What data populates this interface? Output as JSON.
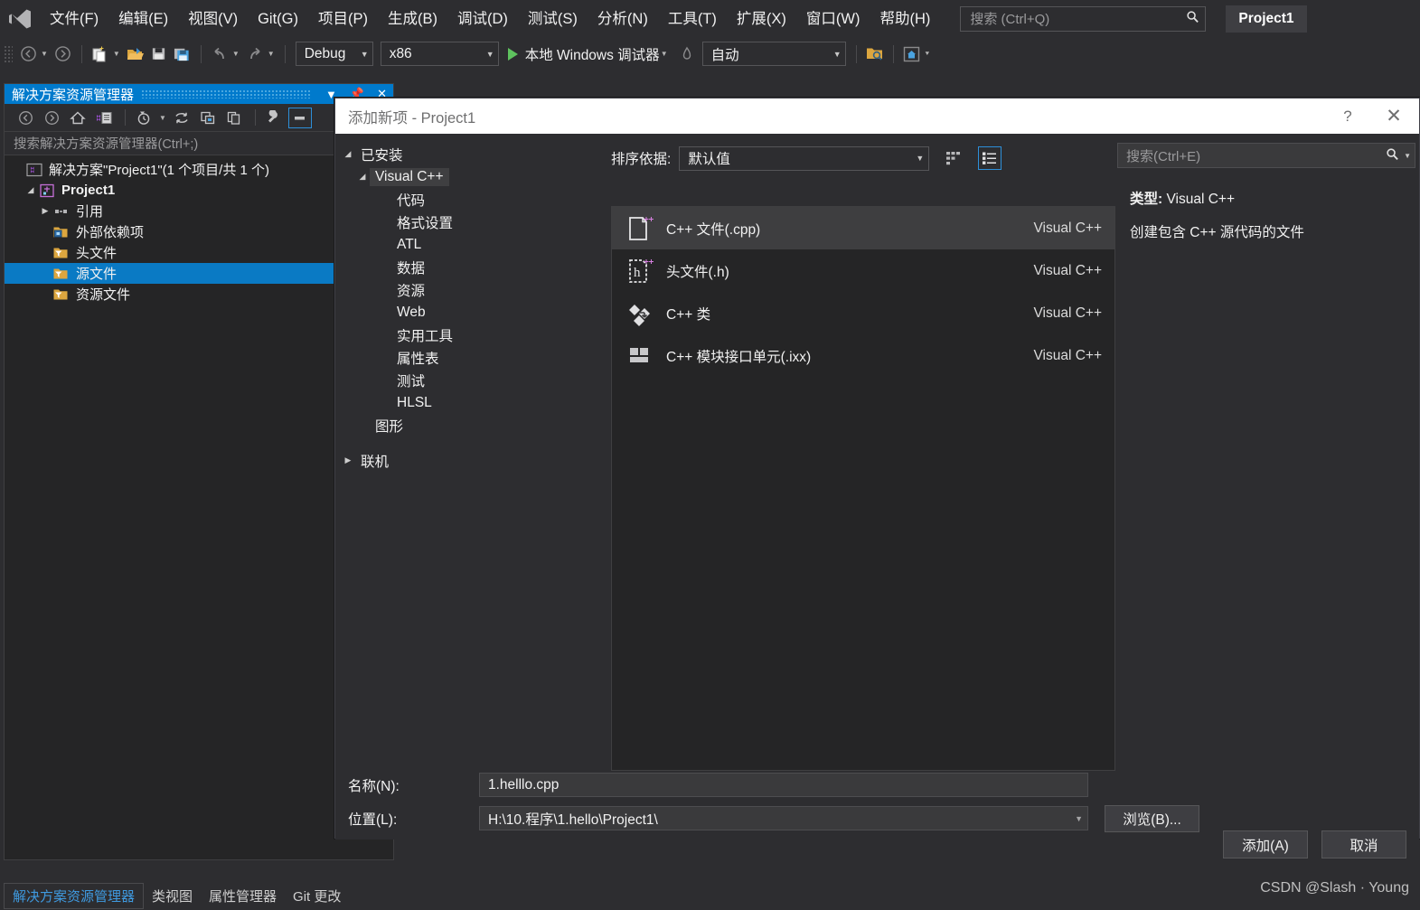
{
  "menubar": {
    "logo_icon": "visual-studio-logo",
    "items": [
      "文件(F)",
      "编辑(E)",
      "视图(V)",
      "Git(G)",
      "项目(P)",
      "生成(B)",
      "调试(D)",
      "测试(S)",
      "分析(N)",
      "工具(T)",
      "扩展(X)",
      "窗口(W)",
      "帮助(H)"
    ],
    "search_placeholder": "搜索 (Ctrl+Q)",
    "search_icon": "search-icon",
    "project_badge": "Project1"
  },
  "toolbar": {
    "nav_back_icon": "back-arrow-icon",
    "nav_forward_icon": "forward-arrow-icon",
    "new_item_icon": "new-file-icon",
    "open_icon": "open-folder-icon",
    "save_icon": "save-icon",
    "save_all_icon": "save-all-icon",
    "undo_icon": "undo-icon",
    "redo_icon": "redo-icon",
    "configuration": "Debug",
    "platform": "x86",
    "run_label": "本地 Windows 调试器",
    "hot_reload_icon": "hot-reload-icon",
    "auto_label": "自动",
    "find_folder_icon": "folder-search-icon",
    "home_icon": "home-box-icon",
    "overflow_icon": "toolbar-overflow-icon"
  },
  "solution_explorer": {
    "title": "解决方案资源管理器",
    "title_dropdown_icon": "chevron-down-icon",
    "pin_icon": "pin-icon",
    "close_icon": "close-icon",
    "toolbar_icons": [
      "back-arrow-icon",
      "forward-arrow-icon",
      "home-icon",
      "switch-views-icon",
      "pending-changes-icon",
      "refresh-icon",
      "show-all-files-icon",
      "copy-icon",
      "properties-icon",
      "collapse-all-icon"
    ],
    "search_placeholder": "搜索解决方案资源管理器(Ctrl+;)",
    "tree": [
      {
        "label": "解决方案\"Project1\"(1 个项目/共 1 个)",
        "icon": "solution-icon",
        "indent": 1,
        "arrow": "none",
        "bold": false,
        "selected": false
      },
      {
        "label": "Project1",
        "icon": "cpp-project-icon",
        "indent": 1,
        "arrow": "down",
        "bold": true,
        "selected": false
      },
      {
        "label": "引用",
        "icon": "references-icon",
        "indent": 2,
        "arrow": "right",
        "bold": false,
        "selected": false
      },
      {
        "label": "外部依赖项",
        "icon": "dependency-folder-icon",
        "indent": 2,
        "arrow": "none",
        "bold": false,
        "selected": false
      },
      {
        "label": "头文件",
        "icon": "filter-folder-icon",
        "indent": 2,
        "arrow": "none",
        "bold": false,
        "selected": false
      },
      {
        "label": "源文件",
        "icon": "filter-folder-icon",
        "indent": 2,
        "arrow": "none",
        "bold": false,
        "selected": true
      },
      {
        "label": "资源文件",
        "icon": "filter-folder-icon",
        "indent": 2,
        "arrow": "none",
        "bold": false,
        "selected": false
      }
    ]
  },
  "dialog": {
    "title": "添加新项 - Project1",
    "help_icon": "help-icon",
    "close_icon": "close-icon",
    "categories": [
      {
        "label": "已安装",
        "indent": 0,
        "arrow": "down",
        "selected": false
      },
      {
        "label": "Visual C++",
        "indent": 1,
        "arrow": "down",
        "selected": true
      },
      {
        "label": "代码",
        "indent": 2,
        "arrow": "none",
        "selected": false
      },
      {
        "label": "格式设置",
        "indent": 2,
        "arrow": "none",
        "selected": false
      },
      {
        "label": "ATL",
        "indent": 2,
        "arrow": "none",
        "selected": false
      },
      {
        "label": "数据",
        "indent": 2,
        "arrow": "none",
        "selected": false
      },
      {
        "label": "资源",
        "indent": 2,
        "arrow": "none",
        "selected": false
      },
      {
        "label": "Web",
        "indent": 2,
        "arrow": "none",
        "selected": false
      },
      {
        "label": "实用工具",
        "indent": 2,
        "arrow": "none",
        "selected": false
      },
      {
        "label": "属性表",
        "indent": 2,
        "arrow": "none",
        "selected": false
      },
      {
        "label": "测试",
        "indent": 2,
        "arrow": "none",
        "selected": false
      },
      {
        "label": "HLSL",
        "indent": 2,
        "arrow": "none",
        "selected": false
      },
      {
        "label": "图形",
        "indent": 1,
        "arrow": "none",
        "selected": false
      },
      {
        "label": "联机",
        "indent": 0,
        "arrow": "right",
        "selected": false
      }
    ],
    "sort_label": "排序依据:",
    "sort_value": "默认值",
    "grid_view_icon": "grid-view-icon",
    "list_view_icon": "list-view-icon",
    "templates": [
      {
        "name": "C++ 文件(.cpp)",
        "vendor": "Visual C++",
        "icon": "cpp-file-icon",
        "selected": true
      },
      {
        "name": "头文件(.h)",
        "vendor": "Visual C++",
        "icon": "header-file-icon",
        "selected": false
      },
      {
        "name": "C++ 类",
        "vendor": "Visual C++",
        "icon": "cpp-class-icon",
        "selected": false
      },
      {
        "name": "C++ 模块接口单元(.ixx)",
        "vendor": "Visual C++",
        "icon": "cpp-module-icon",
        "selected": false
      }
    ],
    "search_placeholder": "搜索(Ctrl+E)",
    "search_icon": "search-icon",
    "search_dropdown_icon": "chevron-down-icon",
    "info_type_label": "类型:",
    "info_type_value": "Visual C++",
    "info_description": "创建包含 C++ 源代码的文件",
    "name_label": "名称(N):",
    "name_value": "1.helllo.cpp",
    "location_label": "位置(L):",
    "location_value": "H:\\10.程序\\1.hello\\Project1\\",
    "location_dropdown_icon": "chevron-down-icon",
    "browse_label": "浏览(B)...",
    "add_label": "添加(A)",
    "cancel_label": "取消"
  },
  "bottom_tabs": [
    {
      "label": "解决方案资源管理器",
      "selected": true
    },
    {
      "label": "类视图",
      "selected": false
    },
    {
      "label": "属性管理器",
      "selected": false
    },
    {
      "label": "Git 更改",
      "selected": false
    }
  ],
  "watermark": "CSDN @Slash · Young",
  "colors": {
    "accent_blue": "#007acc",
    "selection_blue": "#0a7ac4",
    "window_bg": "#2d2d30",
    "panel_bg": "#252526",
    "dialog_title_bg": "#ffffff",
    "run_green": "#5ec25e"
  }
}
